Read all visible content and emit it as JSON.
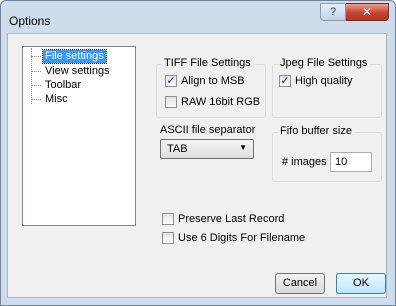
{
  "window": {
    "title": "Options",
    "help_glyph": "?",
    "close_glyph": "✕"
  },
  "tree": {
    "items": [
      {
        "label": "File settings",
        "selected": true
      },
      {
        "label": "View settings",
        "selected": false
      },
      {
        "label": "Toolbar",
        "selected": false
      },
      {
        "label": "Misc",
        "selected": false
      }
    ]
  },
  "tiff": {
    "title": "TIFF File Settings",
    "align_label": "Align to MSB",
    "align_checked": true,
    "raw_label": "RAW 16bit RGB",
    "raw_checked": false
  },
  "jpeg": {
    "title": "Jpeg File Settings",
    "quality_label": "High quality",
    "quality_checked": true
  },
  "ascii": {
    "label": "ASCII file separator",
    "selected": "TAB"
  },
  "fifo": {
    "title": "Fifo buffer size",
    "images_label": "# images",
    "images_value": "10"
  },
  "options": {
    "preserve_label": "Preserve Last Record",
    "preserve_checked": false,
    "six_digits_label": "Use 6 Digits For Filename",
    "six_digits_checked": false
  },
  "buttons": {
    "cancel": "Cancel",
    "ok": "OK"
  }
}
